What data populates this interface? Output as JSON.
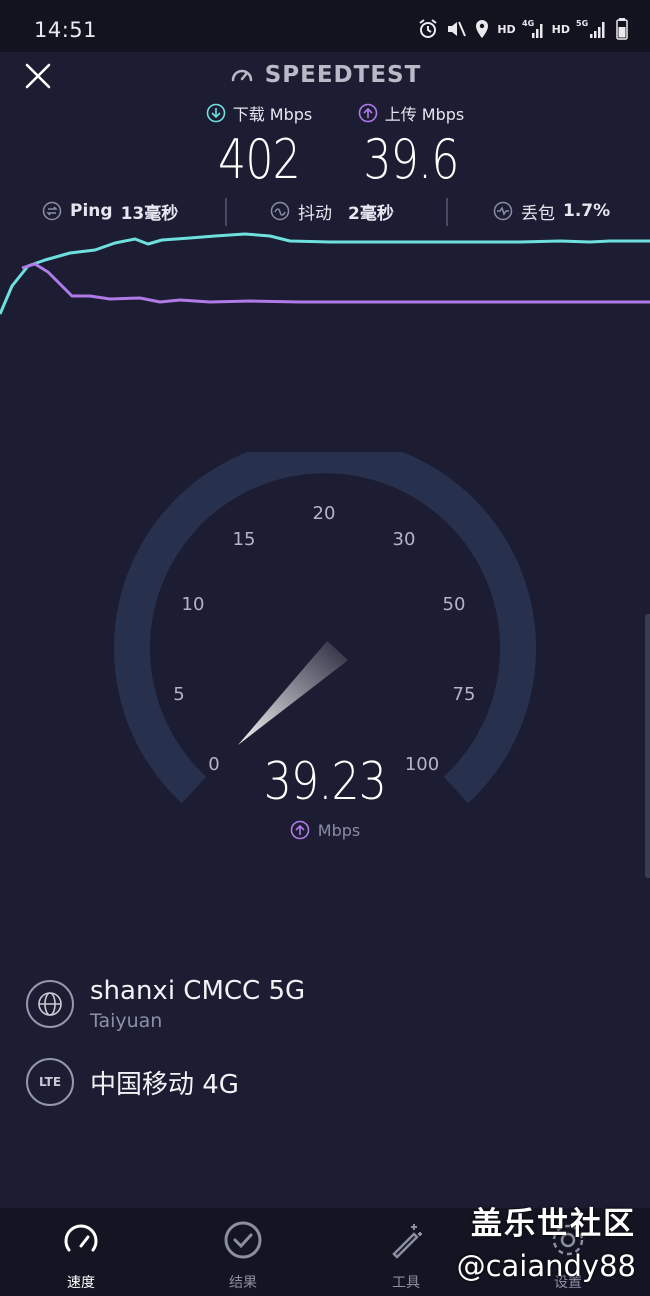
{
  "status_bar": {
    "time": "14:51",
    "icons": [
      "alarm-icon",
      "mute-icon",
      "location-icon",
      "hd-icon",
      "4g-signal-icon",
      "hd-icon",
      "5g-signal-icon",
      "battery-icon"
    ],
    "hd_label": "HD",
    "net_4g": "4G",
    "net_5g": "5G"
  },
  "header": {
    "brand": "SPEEDTEST"
  },
  "metrics": {
    "download_label": "下载 Mbps",
    "download_value": "402",
    "upload_label": "上传 Mbps",
    "upload_value": "39.6"
  },
  "stats": {
    "ping_label": "Ping",
    "ping_value": "13毫秒",
    "jitter_label": "抖动",
    "jitter_value": "2毫秒",
    "loss_label": "丢包",
    "loss_value": "1.7%"
  },
  "colors": {
    "background": "#1c1d32",
    "download": "#6fe0e0",
    "upload": "#b07be8",
    "gauge_track": "#27304d"
  },
  "gauge": {
    "ticks": [
      "0",
      "5",
      "10",
      "15",
      "20",
      "30",
      "50",
      "75",
      "100"
    ],
    "current_value": "39.23",
    "unit": "Mbps"
  },
  "server": {
    "name": "shanxi CMCC 5G",
    "location": "Taiyuan"
  },
  "carrier": {
    "badge": "LTE",
    "name": "中国移动 4G"
  },
  "tabbar": {
    "tabs": [
      {
        "label": "速度",
        "icon": "speedometer-icon",
        "active": true
      },
      {
        "label": "结果",
        "icon": "checkmark-circle-icon",
        "active": false
      },
      {
        "label": "工具",
        "icon": "magic-wand-icon",
        "active": false
      },
      {
        "label": "设置",
        "icon": "gear-icon",
        "active": false
      }
    ]
  },
  "watermark": {
    "title": "盖乐世社区",
    "handle": "@caiandy88"
  }
}
